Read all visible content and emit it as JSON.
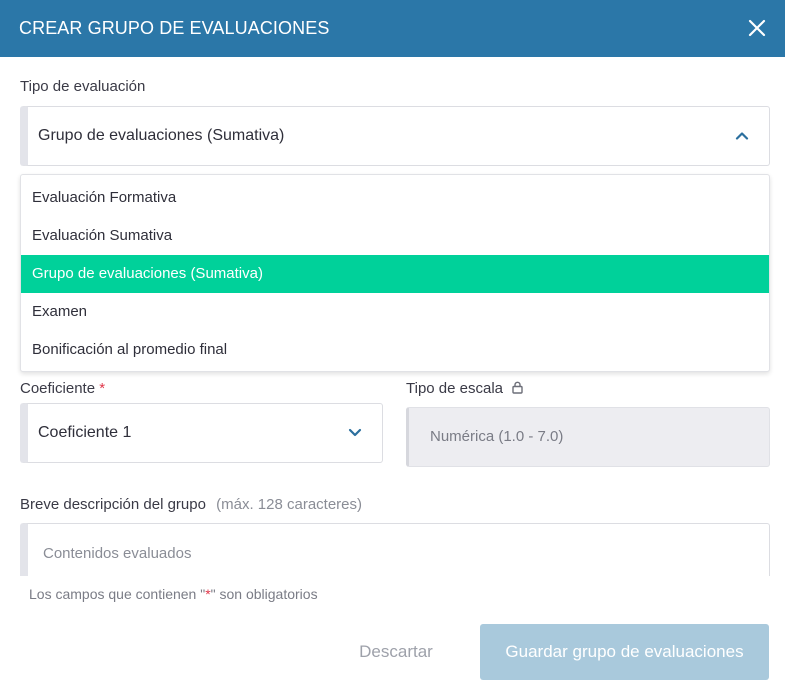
{
  "dialog": {
    "title": "CREAR GRUPO DE EVALUACIONES"
  },
  "evaluation_type": {
    "label": "Tipo de evaluación",
    "selected": "Grupo de evaluaciones (Sumativa)",
    "options": [
      "Evaluación Formativa",
      "Evaluación Sumativa",
      "Grupo de evaluaciones (Sumativa)",
      "Examen",
      "Bonificación al promedio final"
    ],
    "selected_index": 2
  },
  "coefficient": {
    "label": "Coeficiente",
    "required_mark": "*",
    "selected": "Coeficiente 1"
  },
  "scale_type": {
    "label": "Tipo de escala",
    "value": "Numérica (1.0 - 7.0)"
  },
  "description": {
    "label": "Breve descripción del grupo",
    "hint": "(máx. 128 caracteres)",
    "placeholder": "Contenidos evaluados"
  },
  "footnote": {
    "prefix": "Los campos que contienen \"",
    "mark": "*",
    "suffix": "\" son obligatorios"
  },
  "actions": {
    "discard_label": "Descartar",
    "save_label": "Guardar grupo de evaluaciones"
  },
  "colors": {
    "header": "#2b77a8",
    "selected_option": "#00d19a",
    "save_button": "#a9c9dc",
    "required": "#e0374a"
  }
}
